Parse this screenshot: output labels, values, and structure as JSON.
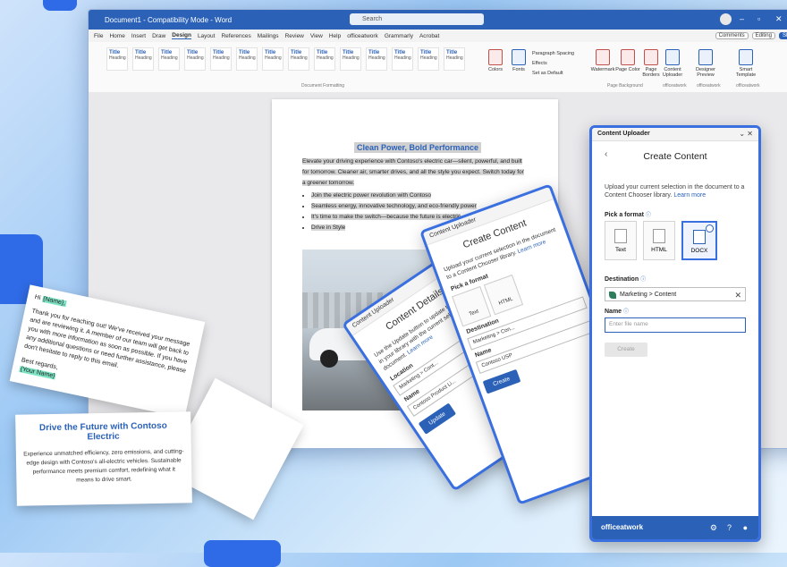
{
  "word": {
    "doc_title": "Document1 - Compatibility Mode - Word",
    "search_placeholder": "Search",
    "menu": [
      "File",
      "Home",
      "Insert",
      "Draw",
      "Design",
      "Layout",
      "References",
      "Mailings",
      "Review",
      "View",
      "Help",
      "officeatwork",
      "Grammarly",
      "Acrobat"
    ],
    "active_menu": "Design",
    "comments": "Comments",
    "editing": "Editing",
    "share": "Share",
    "doc_formatting_label": "Document Formatting",
    "paragraph_spacing": "Paragraph Spacing",
    "effects": "Effects",
    "set_default": "Set as Default",
    "colors": "Colors",
    "fonts": "Fonts",
    "watermark": "Watermark",
    "page_color": "Page Color",
    "page_borders": "Page Borders",
    "page_background_label": "Page Background",
    "content_uploader": "Content Uploader",
    "designer_preview": "Designer Preview",
    "smart_template": "Smart Template",
    "officeatwork1": "officeatwork",
    "officeatwork2": "officeatwork",
    "officeatwork3": "officeatwork"
  },
  "document": {
    "heading": "Clean Power, Bold Performance",
    "paragraph": "Elevate your driving experience with Contoso's electric car—silent, powerful, and built for tomorrow. Cleaner air, smarter drives, and all the style you expect. Switch today for a greener tomorrow.",
    "bullets": [
      "Join the electric power revolution with Contoso",
      "Seamless energy, innovative technology, and eco-friendly power",
      "It's time to make the switch—because the future is electric",
      "Drive in Style"
    ]
  },
  "email_card": {
    "greeting": "Hi",
    "name_tag": "{Name},",
    "body": "Thank you for reaching out! We've received your message and are reviewing it. A member of our team will get back to you with more information as soon as possible. If you have any additional questions or need further assistance, please don't hesitate to reply to this email.",
    "sign": "Best regards,",
    "your_name": "{Your Name}"
  },
  "ad_card": {
    "title": "Drive the Future with Contoso Electric",
    "body": "Experience unmatched efficiency, zero emissions, and cutting-edge design with Contoso's all-electric vehicles. Sustainable performance meets premium comfort, redefining what it means to drive smart."
  },
  "panel_back1": {
    "header": "Content Uploader",
    "title": "Content Details",
    "desc": "Use the Update button to update the content in your library with the current selection in the document.",
    "learn": "Learn more",
    "location": "Location",
    "location_value": "Marketing > Cont...",
    "name": "Name",
    "name_value": "Contoso Product Li...",
    "update": "Update"
  },
  "panel_back2": {
    "header": "Content Uploader",
    "title": "Create Content",
    "desc": "Upload your current selection in the document to a Content Chooser library.",
    "learn": "Learn more",
    "pick": "Pick a format",
    "fmt_text": "Text",
    "fmt_html": "HTML",
    "destination": "Destination",
    "dest_value": "Marketing > Con...",
    "name": "Name",
    "name_value": "Contoso USP",
    "create": "Create"
  },
  "panel_main": {
    "header": "Content Uploader",
    "title": "Create Content",
    "desc": "Upload your current selection in the document to a Content Chooser library.",
    "learn": "Learn more",
    "pick": "Pick a format",
    "fmt_text": "Text",
    "fmt_html": "HTML",
    "fmt_docx": "DOCX",
    "destination": "Destination",
    "dest_value": "Marketing > Content",
    "name": "Name",
    "name_placeholder": "Enter file name",
    "create": "Create",
    "brand": "officeatwork"
  },
  "colors": {
    "accent": "#2b62b8",
    "panel_border": "#3a6fe0",
    "tag": "#7ee3c4"
  }
}
